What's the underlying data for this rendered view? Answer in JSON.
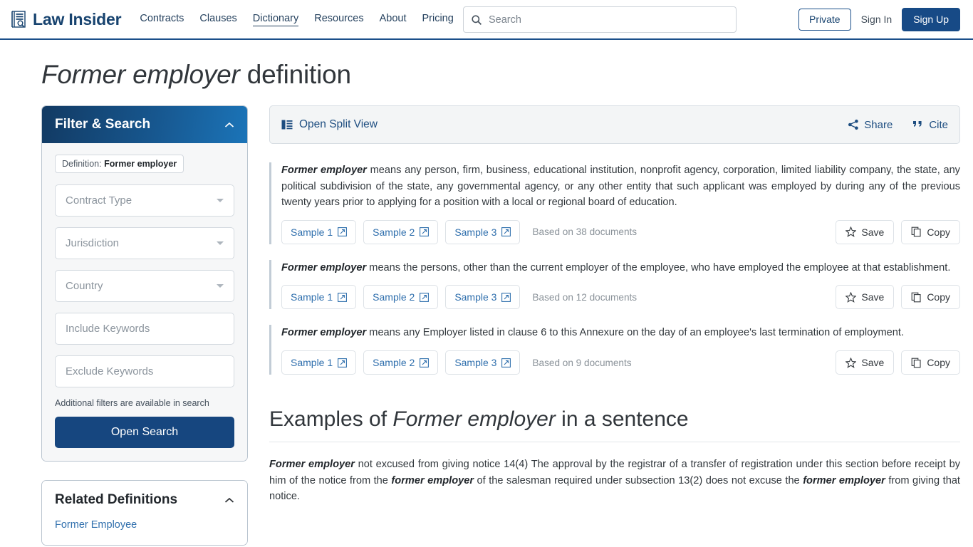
{
  "header": {
    "logo_text": "Law Insider",
    "logo_icon": "document-search-icon",
    "nav": [
      {
        "label": "Contracts",
        "active": false
      },
      {
        "label": "Clauses",
        "active": false
      },
      {
        "label": "Dictionary",
        "active": true
      },
      {
        "label": "Resources",
        "active": false
      },
      {
        "label": "About",
        "active": false
      },
      {
        "label": "Pricing",
        "active": false
      }
    ],
    "search": {
      "placeholder": "Search",
      "value": "",
      "icon": "search-icon"
    },
    "private_label": "Private",
    "signin_label": "Sign In",
    "signup_label": "Sign Up"
  },
  "page": {
    "title_term": "Former employer",
    "title_suffix": " definition"
  },
  "sidebar": {
    "filter": {
      "title": "Filter & Search",
      "collapse_icon": "chevron-up-icon",
      "chip_label": "Definition:",
      "chip_value": "Former employer",
      "fields": [
        {
          "name": "contract-type",
          "placeholder": "Contract Type",
          "value": "",
          "type": "select"
        },
        {
          "name": "jurisdiction",
          "placeholder": "Jurisdiction",
          "value": "",
          "type": "select"
        },
        {
          "name": "country",
          "placeholder": "Country",
          "value": "",
          "type": "select"
        },
        {
          "name": "include-keywords",
          "placeholder": "Include Keywords",
          "value": "",
          "type": "text"
        },
        {
          "name": "exclude-keywords",
          "placeholder": "Exclude Keywords",
          "value": "",
          "type": "text"
        }
      ],
      "hint": "Additional filters are available in search",
      "open_search_label": "Open Search"
    },
    "related": {
      "title": "Related Definitions",
      "collapse_icon": "chevron-up-icon",
      "items": [
        {
          "label": "Former Employee"
        }
      ]
    }
  },
  "main": {
    "toolbar": {
      "split_view_label": "Open Split View",
      "split_view_icon": "split-view-icon",
      "share_label": "Share",
      "share_icon": "share-icon",
      "cite_label": "Cite",
      "cite_icon": "quote-icon"
    },
    "definitions": [
      {
        "term": "Former employer",
        "text": " means any person, firm, business, educational institution, nonprofit agency, corporation, limited liability company, the state, any political subdivision of the state, any governmental agency, or any other entity that such applicant was employed by during any of the previous twenty years prior to applying for a position with a local or regional board of education.",
        "samples": [
          "Sample 1",
          "Sample 2",
          "Sample 3"
        ],
        "based_on": "Based on 38 documents",
        "save_label": "Save",
        "copy_label": "Copy"
      },
      {
        "term": "Former employer",
        "text": " means the persons, other than the current employer of the employee, who have employed the employee at that establishment.",
        "samples": [
          "Sample 1",
          "Sample 2",
          "Sample 3"
        ],
        "based_on": "Based on 12 documents",
        "save_label": "Save",
        "copy_label": "Copy"
      },
      {
        "term": "Former employer",
        "text": " means any Employer listed in clause 6 to this Annexure on the day of an employee's last termination of employment.",
        "samples": [
          "Sample 1",
          "Sample 2",
          "Sample 3"
        ],
        "based_on": "Based on 9 documents",
        "save_label": "Save",
        "copy_label": "Copy"
      }
    ],
    "examples": {
      "heading_prefix": "Examples of ",
      "heading_term": "Former employer",
      "heading_suffix": " in a sentence",
      "entry": {
        "lead_term": "Former employer",
        "part1": " not excused from giving notice 14(4) The approval by the registrar of a transfer of registration under this section before receipt by him of the notice from the ",
        "term2": "former employer",
        "part2": " of the salesman required under subsection 13(2) does not excuse the ",
        "term3": "former employer",
        "part3": " from giving that notice."
      }
    }
  },
  "colors": {
    "brand_navy": "#17436f",
    "brand_blue": "#174a86",
    "link_blue": "#2f6fad",
    "sidebar_gradient_start": "#123a63",
    "sidebar_gradient_end": "#1b74b8"
  }
}
